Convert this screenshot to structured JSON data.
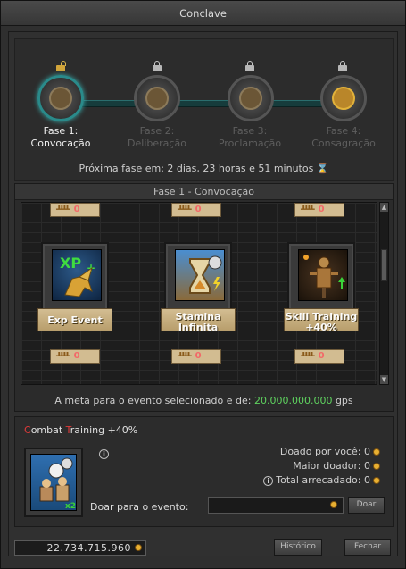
{
  "window": {
    "title": "Conclave"
  },
  "phases": [
    {
      "label_line1": "Fase 1:",
      "label_line2": "Convocação",
      "active": true,
      "locked": false
    },
    {
      "label_line1": "Fase 2:",
      "label_line2": "Deliberação",
      "active": false,
      "locked": true
    },
    {
      "label_line1": "Fase 3:",
      "label_line2": "Proclamação",
      "active": false,
      "locked": true
    },
    {
      "label_line1": "Fase 4:",
      "label_line2": "Consagração",
      "active": false,
      "locked": true
    }
  ],
  "next_phase": {
    "text": "Próxima fase em: 2 dias, 23 horas e 51 minutos",
    "icon": "hourglass-icon"
  },
  "events_panel": {
    "title": "Fase 1 - Convocação",
    "top_costs": [
      "0",
      "0",
      "0"
    ],
    "cards": [
      {
        "name_line1": "Exp Event",
        "name_line2": "",
        "cost": "0",
        "icon": "xp-griffin-icon"
      },
      {
        "name_line1": "Stamina",
        "name_line2": "Infinita",
        "cost": "0",
        "icon": "hourglass-stamina-icon"
      },
      {
        "name_line1": "Skill Training",
        "name_line2": "+40%",
        "cost": "0",
        "icon": "training-dummy-icon"
      }
    ],
    "goal_prefix": "A meta para o evento selecionado e de:",
    "goal_value": "20.000.000.000",
    "goal_unit": "gps"
  },
  "selected_event": {
    "name_first_letter": "C",
    "name_part1": "ombat ",
    "name_second_letter": "T",
    "name_part2": "raining +40%",
    "donated_by_you_label": "Doado por você:",
    "donated_by_you_value": "0",
    "top_donor_label": "Maior doador:",
    "top_donor_value": "0",
    "total_label": "Total arrecadado:",
    "total_value": "0",
    "donate_label": "Doar para o evento:",
    "donate_input_value": "",
    "donate_button": "Doar"
  },
  "footer": {
    "balance": "22.734.715.960",
    "history_button": "Histórico",
    "close_button": "Fechar"
  },
  "colors": {
    "accent_green": "#5fd35f",
    "accent_red": "#e03a3a",
    "coin_gold": "#e8b032",
    "active_ring": "#2a8a8a"
  }
}
